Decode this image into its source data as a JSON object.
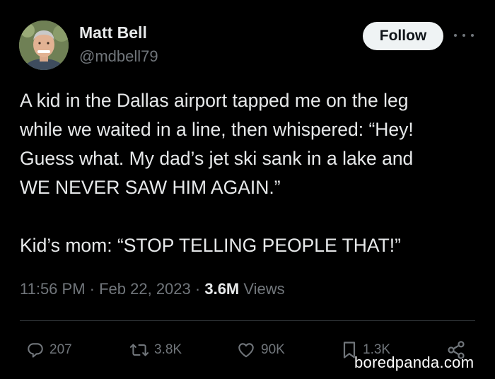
{
  "author": {
    "display_name": "Matt Bell",
    "handle": "@mdbell79"
  },
  "header": {
    "follow_label": "Follow",
    "more_icon": "more-horizontal-icon"
  },
  "tweet": {
    "lines": [
      "A kid in the Dallas airport tapped me on the leg",
      "while we waited in a line, then whispered: “Hey!",
      "Guess what. My dad’s jet ski sank in a lake and",
      "WE NEVER SAW HIM AGAIN.”",
      "Kid’s mom: “STOP TELLING PEOPLE THAT!”"
    ]
  },
  "meta": {
    "time": "11:56 PM",
    "separator": " · ",
    "date": "Feb 22, 2023",
    "views_count": "3.6M",
    "views_label": " Views"
  },
  "actions": {
    "reply_count": "207",
    "repost_count": "3.8K",
    "like_count": "90K",
    "bookmark_count": "1.3K"
  },
  "watermark": "boredpanda.com",
  "colors": {
    "background": "#000000",
    "text_primary": "#e7e9ea",
    "text_secondary": "#71767b",
    "follow_bg": "#eff3f4",
    "divider": "#2f3336"
  }
}
